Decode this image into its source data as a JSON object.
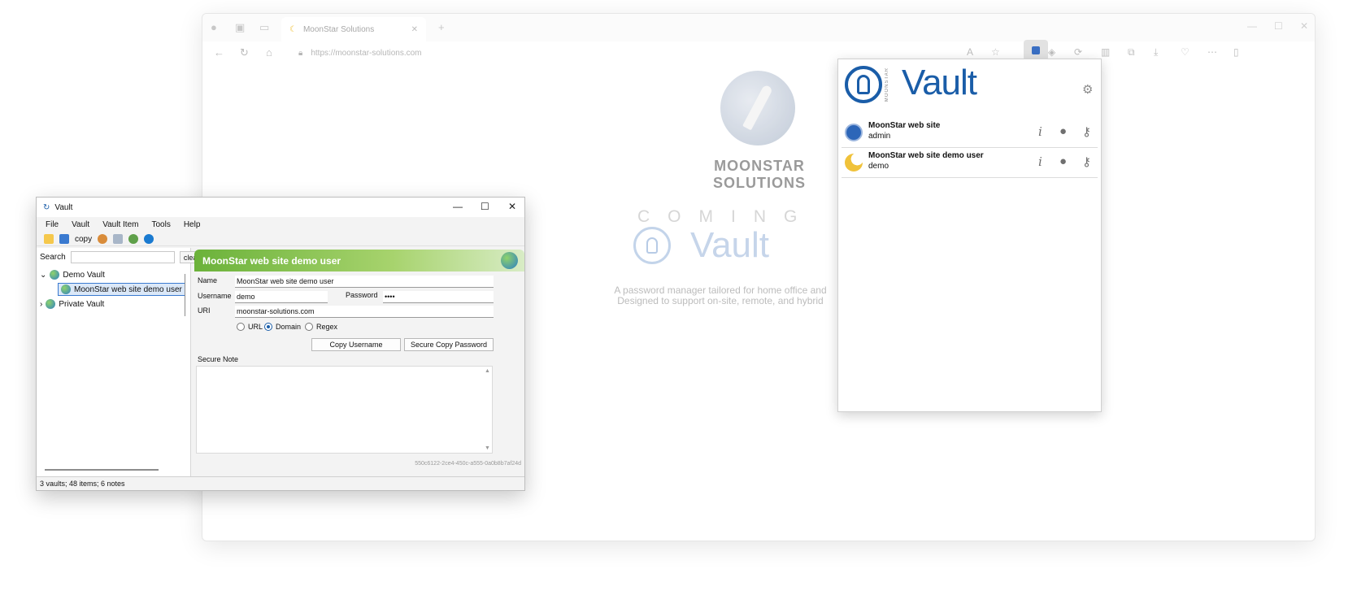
{
  "browser": {
    "tab_title": "MoonStar Solutions",
    "url": "https://moonstar-solutions.com",
    "page": {
      "company": "MOONSTAR SOLUTIONS",
      "coming": "COMING SO",
      "vault_word": "Vault",
      "tagline_1": "A password manager tailored for home office and",
      "tagline_2": "Designed to support on-site, remote, and hybrid"
    }
  },
  "popup": {
    "brand_small": "MOONSTAR",
    "title": "Vault",
    "items": [
      {
        "name": "MoonStar web site",
        "user": "admin"
      },
      {
        "name": "MoonStar web site demo user",
        "user": "demo"
      }
    ],
    "icons": {
      "info": "i",
      "user": "👤",
      "key": "⚷"
    }
  },
  "app": {
    "title": "Vault",
    "menu": [
      "File",
      "Vault",
      "Vault Item",
      "Tools",
      "Help"
    ],
    "toolbar_copy": "copy",
    "search_label": "Search",
    "search_value": "",
    "clear_label": "clear",
    "tree": {
      "vault1": "Demo Vault",
      "item1": "MoonStar web site demo user",
      "vault2": "Private Vault"
    },
    "detail": {
      "header": "MoonStar web site demo user",
      "name_label": "Name",
      "name_value": "MoonStar web site demo user",
      "username_label": "Username",
      "username_value": "demo",
      "password_label": "Password",
      "password_value": "••••",
      "uri_label": "URI",
      "uri_value": "moonstar-solutions.com",
      "match_options": [
        "URL",
        "Domain",
        "Regex"
      ],
      "match_selected": "Domain",
      "copy_username": "Copy Username",
      "secure_copy_password": "Secure Copy Password",
      "secure_note_label": "Secure Note",
      "guid": "550c6122-2ce4-450c-a555-0a0b8b7af24d"
    },
    "status": "3 vaults; 48 items; 6 notes"
  }
}
